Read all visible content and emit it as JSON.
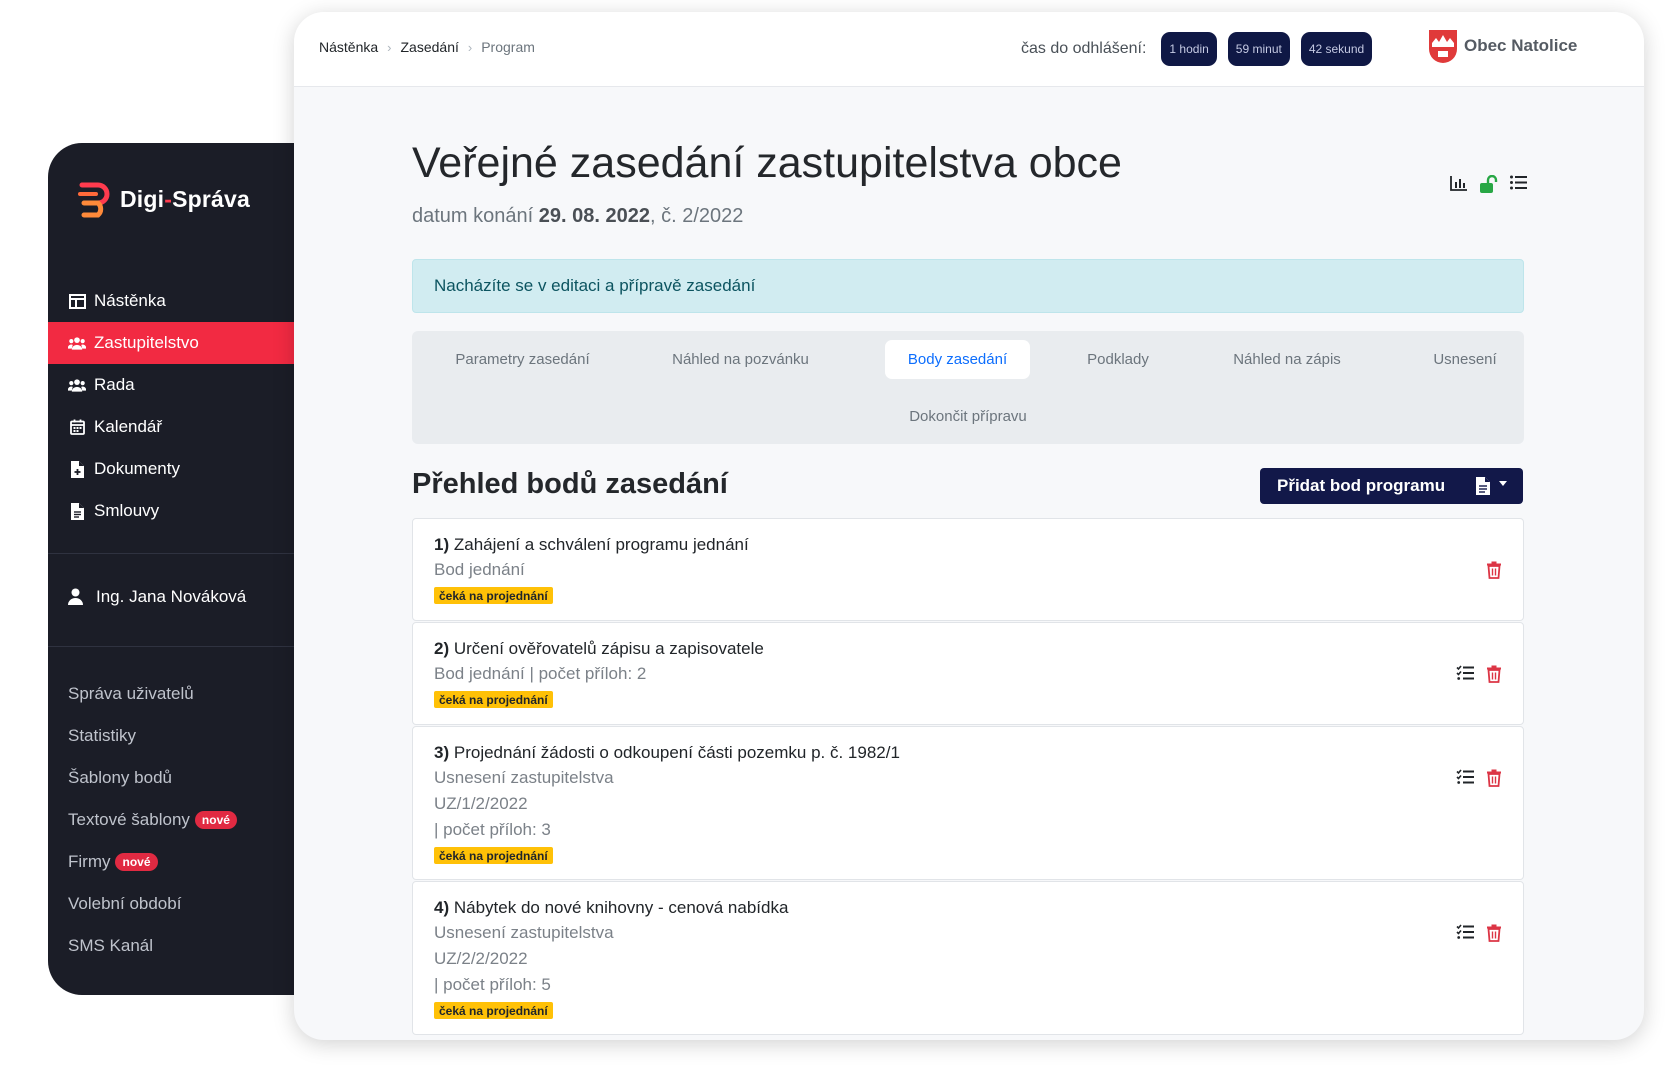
{
  "sidebar": {
    "brand": {
      "part1": "Digi",
      "dash": "-",
      "part2": "Správa"
    },
    "nav": [
      {
        "label": "Nástěnka",
        "icon": "dashboard-icon",
        "active": false
      },
      {
        "label": "Zastupitelstvo",
        "icon": "users-icon",
        "active": true
      },
      {
        "label": "Rada",
        "icon": "users-icon",
        "active": false
      },
      {
        "label": "Kalendář",
        "icon": "calendar-icon",
        "active": false
      },
      {
        "label": "Dokumenty",
        "icon": "file-add-icon",
        "active": false
      },
      {
        "label": "Smlouvy",
        "icon": "file-text-icon",
        "active": false
      }
    ],
    "user": "Ing. Jana Nováková",
    "admin": [
      {
        "label": "Správa uživatelů"
      },
      {
        "label": "Statistiky"
      },
      {
        "label": "Šablony bodů"
      },
      {
        "label": "Textové šablony",
        "badge": "nové"
      },
      {
        "label": "Firmy",
        "badge": "nové"
      },
      {
        "label": "Volební období"
      },
      {
        "label": "SMS Kanál"
      }
    ],
    "colors": {
      "background": "#1b1d27",
      "active": "#f22a42"
    }
  },
  "header": {
    "breadcrumb": [
      "Nástěnka",
      "Zasedání",
      "Program"
    ],
    "timer_label": "čas do odhlášení:",
    "timer": [
      "1 hodin",
      "59 minut",
      "42 sekund"
    ],
    "municipality": "Obec Natolice"
  },
  "page": {
    "title": "Veřejné zasedání zastupitelstva obce",
    "meta_prefix": "datum konání",
    "meta_date": "29. 08. 2022",
    "meta_suffix": ", č. 2/2022",
    "alert": "Nacházíte se v editaci a přípravě zasedání",
    "icons": [
      "chart-icon",
      "unlock-icon",
      "list-icon"
    ]
  },
  "tabs": [
    {
      "label": "Parametry zasedání",
      "active": false
    },
    {
      "label": "Náhled na pozvánku",
      "active": false
    },
    {
      "label": "Body zasedání",
      "active": true
    },
    {
      "label": "Podklady",
      "active": false
    },
    {
      "label": "Náhled na zápis",
      "active": false
    },
    {
      "label": "Usnesení",
      "active": false
    },
    {
      "label": "Dokončit přípravu",
      "active": false
    }
  ],
  "section": {
    "title": "Přehled bodů zasedání",
    "add_button": "Přidat bod programu"
  },
  "items": [
    {
      "num": "1)",
      "title": "Zahájení a schválení programu jednání",
      "lines": [
        "Bod jednání"
      ],
      "status": "čeká na projednání",
      "has_checklist": false
    },
    {
      "num": "2)",
      "title": "Určení ověřovatelů zápisu a zapisovatele",
      "lines": [
        "Bod jednání  | počet příloh: 2"
      ],
      "status": "čeká na projednání",
      "has_checklist": true
    },
    {
      "num": "3)",
      "title": "Projednání žádosti o odkoupení části pozemku p. č. 1982/1",
      "lines": [
        "Usnesení zastupitelstva",
        "UZ/1/2/2022",
        "| počet příloh: 3"
      ],
      "status": "čeká na projednání",
      "has_checklist": true
    },
    {
      "num": "4)",
      "title": "Nábytek do nové knihovny - cenová nabídka",
      "lines": [
        "Usnesení zastupitelstva",
        "UZ/2/2/2022",
        "| počet příloh: 5"
      ],
      "status": "čeká na projednání",
      "has_checklist": true
    }
  ],
  "colors": {
    "accent": "#0d6efd",
    "primary_button": "#121849",
    "status": "#ffc107",
    "danger": "#dc3545",
    "unlock": "#28a745"
  }
}
